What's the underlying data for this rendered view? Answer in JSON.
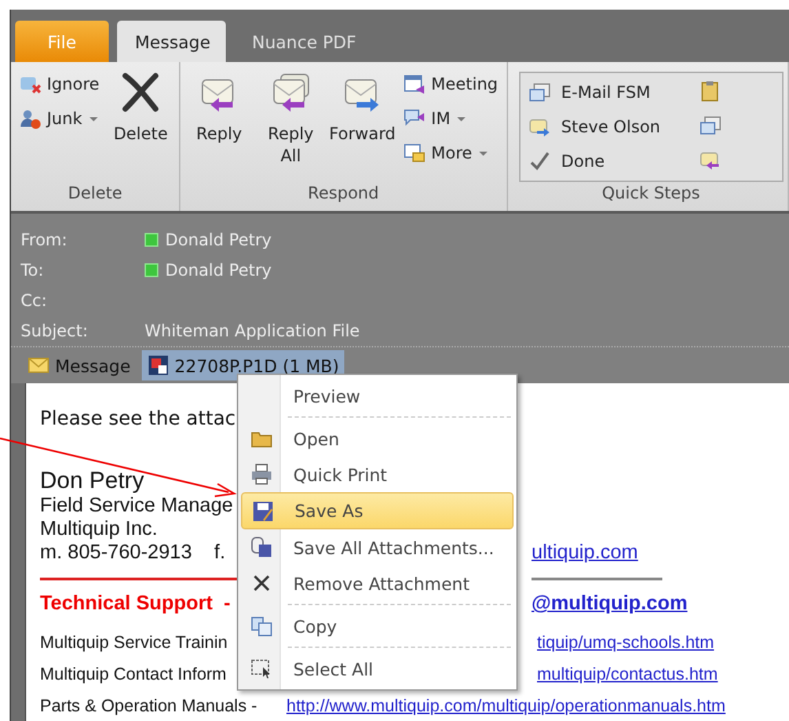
{
  "tabs": [
    {
      "label": "File",
      "kind": "file",
      "selected": false
    },
    {
      "label": "Message",
      "kind": "tab",
      "selected": true
    },
    {
      "label": "Nuance PDF",
      "kind": "tab",
      "selected": false
    }
  ],
  "ribbon": {
    "groups": [
      {
        "label": "Delete",
        "columns": [
          [
            {
              "label": "Ignore",
              "kind": "small",
              "dropdown": false
            },
            {
              "label": "Junk",
              "kind": "small",
              "dropdown": true
            }
          ],
          [
            {
              "label": "Delete",
              "kind": "large",
              "dropdown": false
            }
          ]
        ]
      },
      {
        "label": "Respond",
        "columns": [
          [
            {
              "label": "Reply",
              "kind": "large",
              "dropdown": false
            }
          ],
          [
            {
              "label": "Reply All",
              "kind": "large",
              "dropdown": false
            }
          ],
          [
            {
              "label": "Forward",
              "kind": "large",
              "dropdown": false
            }
          ],
          [
            {
              "label": "Meeting",
              "kind": "small",
              "dropdown": false
            },
            {
              "label": "IM",
              "kind": "small",
              "dropdown": true
            },
            {
              "label": "More",
              "kind": "small",
              "dropdown": true
            }
          ]
        ]
      },
      {
        "label": "Quick Steps",
        "quick_steps": [
          {
            "label": "E-Mail FSM"
          },
          {
            "label": "Steve Olson"
          },
          {
            "label": "Done"
          }
        ]
      }
    ]
  },
  "header": [
    {
      "label": "From:",
      "value": "Donald Petry",
      "presence": true
    },
    {
      "label": "To:",
      "value": "Donald Petry",
      "presence": true
    },
    {
      "label": "Cc:",
      "presence": false
    },
    {
      "label": "Subject:",
      "value": "Whiteman Application File",
      "presence": false
    }
  ],
  "attachments": [
    {
      "label": "Message",
      "kind": "message",
      "selected": false
    },
    {
      "label": "22708P.P1D (1 MB)",
      "kind": "file",
      "selected": true
    }
  ],
  "body": [
    {
      "kind": "greeting",
      "left": "Please see the attac"
    },
    {
      "kind": "name",
      "left": "Don Petry"
    },
    {
      "kind": "line",
      "left": "Field Service Manage"
    },
    {
      "kind": "line",
      "left": "Multiquip Inc."
    },
    {
      "kind": "line",
      "left": "m. 805-760-2913    f.",
      "right": "ultiquip.com"
    },
    {
      "kind": "rule"
    },
    {
      "kind": "heading",
      "left": "Technical Support  -",
      "right": "@multiquip.com"
    },
    {
      "kind": "small",
      "left": "Multiquip Service Trainin",
      "right": "tiquip/umq-schools.htm"
    },
    {
      "kind": "small",
      "left": "Multiquip Contact Inform",
      "right": "multiquip/contactus.htm"
    },
    {
      "kind": "small",
      "left": "Parts & Operation Manuals -",
      "right": "http://www.multiquip.com/multiquip/operationmanuals.htm",
      "wide": true
    }
  ],
  "context_menu": [
    {
      "kind": "item",
      "label": "Preview",
      "selected": false
    },
    {
      "kind": "separator"
    },
    {
      "kind": "item",
      "label": "Open",
      "selected": false
    },
    {
      "kind": "item",
      "label": "Quick Print",
      "selected": false
    },
    {
      "kind": "item",
      "label": "Save As",
      "selected": true
    },
    {
      "kind": "item",
      "label": "Save All Attachments...",
      "selected": false
    },
    {
      "kind": "item",
      "label": "Remove Attachment",
      "selected": false
    },
    {
      "kind": "separator"
    },
    {
      "kind": "item",
      "label": "Copy",
      "selected": false
    },
    {
      "kind": "separator"
    },
    {
      "kind": "item",
      "label": "Select All",
      "selected": false
    }
  ]
}
